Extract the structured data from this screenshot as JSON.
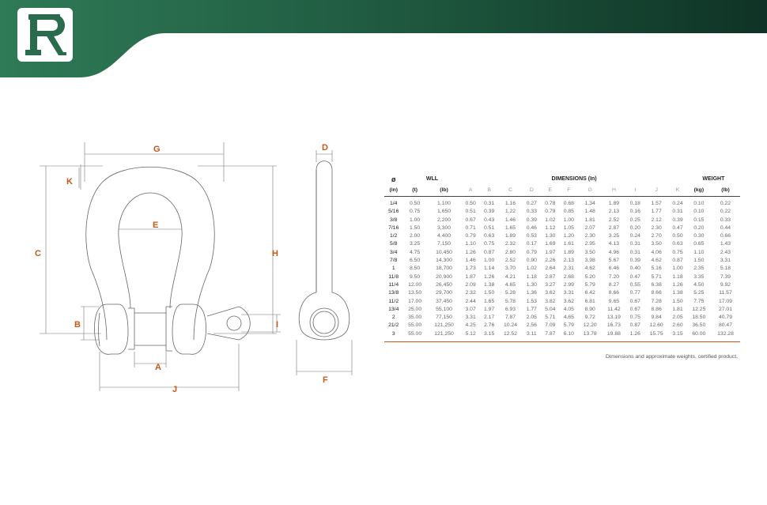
{
  "brand": {
    "logo_letter": "R",
    "primary_color": "#2a6b4e",
    "accent_color": "#c8571a"
  },
  "drawing_labels": {
    "front": [
      "G",
      "K",
      "C",
      "E",
      "H",
      "B",
      "I",
      "A",
      "J"
    ],
    "side": [
      "D",
      "F"
    ]
  },
  "table": {
    "header_diameter_symbol": "ø",
    "header_wll": "WLL",
    "header_dimensions": "DIMENSIONS (In)",
    "header_weight": "WEIGHT",
    "columns": [
      "(in)",
      "(t)",
      "(lb)",
      "A",
      "B",
      "C",
      "D",
      "E",
      "F",
      "G",
      "H",
      "I",
      "J",
      "K",
      "(kg)",
      "(lb)"
    ],
    "rows": [
      [
        "1/4",
        "0.50",
        "1,100",
        "0.50",
        "0.31",
        "1.16",
        "0.27",
        "0.78",
        "0.68",
        "1.34",
        "1.89",
        "0.18",
        "1.57",
        "0.24",
        "0.10",
        "0.22"
      ],
      [
        "5/16",
        "0.75",
        "1,650",
        "0.51",
        "0.39",
        "1.22",
        "0.33",
        "0.79",
        "0.85",
        "1.48",
        "2.13",
        "0.16",
        "1.77",
        "0.31",
        "0.10",
        "0.22"
      ],
      [
        "3/8",
        "1.00",
        "2,200",
        "0.67",
        "0.43",
        "1.46",
        "0.39",
        "1.02",
        "1.00",
        "1.81",
        "2.52",
        "0.25",
        "2.12",
        "0.39",
        "0.15",
        "0.33"
      ],
      [
        "7/16",
        "1.50",
        "3,300",
        "0.71",
        "0.51",
        "1.65",
        "0.46",
        "1.12",
        "1.05",
        "2.07",
        "2.87",
        "0.20",
        "2.30",
        "0.47",
        "0.20",
        "0.44"
      ],
      [
        "1/2",
        "2.00",
        "4,400",
        "0.79",
        "0.63",
        "1.89",
        "0.53",
        "1.30",
        "1.20",
        "2.30",
        "3.25",
        "0.24",
        "2.70",
        "0.50",
        "0.30",
        "0.66"
      ],
      [
        "5/8",
        "3.25",
        "7,150",
        "1.10",
        "0.75",
        "2.32",
        "0.17",
        "1.69",
        "1.61",
        "2.95",
        "4.13",
        "0.31",
        "3.50",
        "0.63",
        "0.65",
        "1.43"
      ],
      [
        "3/4",
        "4.75",
        "10,450",
        "1.26",
        "0.87",
        "2.80",
        "0.79",
        "1.97",
        "1.89",
        "3.50",
        "4.96",
        "0.31",
        "4.06",
        "0.75",
        "1.10",
        "2.43"
      ],
      [
        "7/8",
        "6.50",
        "14,300",
        "1.46",
        "1.00",
        "2.52",
        "0.90",
        "2.26",
        "2.13",
        "3.98",
        "5.67",
        "0.39",
        "4.62",
        "0.87",
        "1.50",
        "3.31"
      ],
      [
        "1",
        "8.50",
        "18,700",
        "1.73",
        "1.14",
        "3.70",
        "1.02",
        "2.64",
        "2.31",
        "4.62",
        "6.46",
        "0.40",
        "5.16",
        "1.00",
        "2.35",
        "5.18"
      ],
      [
        "11/8",
        "9.50",
        "20,900",
        "1.87",
        "1.26",
        "4.21",
        "1.18",
        "2.87",
        "2.68",
        "5.20",
        "7.20",
        "0.47",
        "5.71",
        "1.18",
        "3.35",
        "7.39"
      ],
      [
        "11/4",
        "12.00",
        "26,450",
        "2.09",
        "1.38",
        "4.65",
        "1.30",
        "3.27",
        "2.99",
        "5.79",
        "8.27",
        "0.55",
        "6.38",
        "1.26",
        "4.50",
        "9.92"
      ],
      [
        "13/8",
        "13.50",
        "29,700",
        "2.32",
        "1.50",
        "5.28",
        "1.36",
        "3.62",
        "3.31",
        "6.42",
        "8.66",
        "0.77",
        "8.66",
        "1.38",
        "5.25",
        "11.57"
      ],
      [
        "11/2",
        "17.00",
        "37,450",
        "2.44",
        "1.65",
        "5.78",
        "1.53",
        "3.82",
        "3.62",
        "6.81",
        "9.65",
        "0.67",
        "7.28",
        "1.50",
        "7.75",
        "17.09"
      ],
      [
        "13/4",
        "25.00",
        "55,100",
        "3.07",
        "1.97",
        "6.93",
        "1.77",
        "5.04",
        "4.05",
        "8.90",
        "11.42",
        "0.67",
        "8.86",
        "1.81",
        "12.25",
        "27.01"
      ],
      [
        "2",
        "35.00",
        "77,150",
        "3.31",
        "2.17",
        "7.87",
        "2.05",
        "5.71",
        "4.65",
        "9.72",
        "13.19",
        "0.75",
        "9.84",
        "2.05",
        "18.50",
        "40.79"
      ],
      [
        "21/2",
        "55.00",
        "121,250",
        "4.25",
        "2.76",
        "10.24",
        "2.56",
        "7.09",
        "5.79",
        "12.20",
        "16.73",
        "0.87",
        "12.60",
        "2.60",
        "36.50",
        "80.47"
      ],
      [
        "3",
        "55.00",
        "121,250",
        "5.12",
        "3.15",
        "12.52",
        "3.11",
        "7.87",
        "6.10",
        "13.78",
        "19.88",
        "1.26",
        "15.75",
        "3.15",
        "60.00",
        "132.28"
      ]
    ],
    "footnote": "Dimensions and approximate weights, certified product."
  }
}
